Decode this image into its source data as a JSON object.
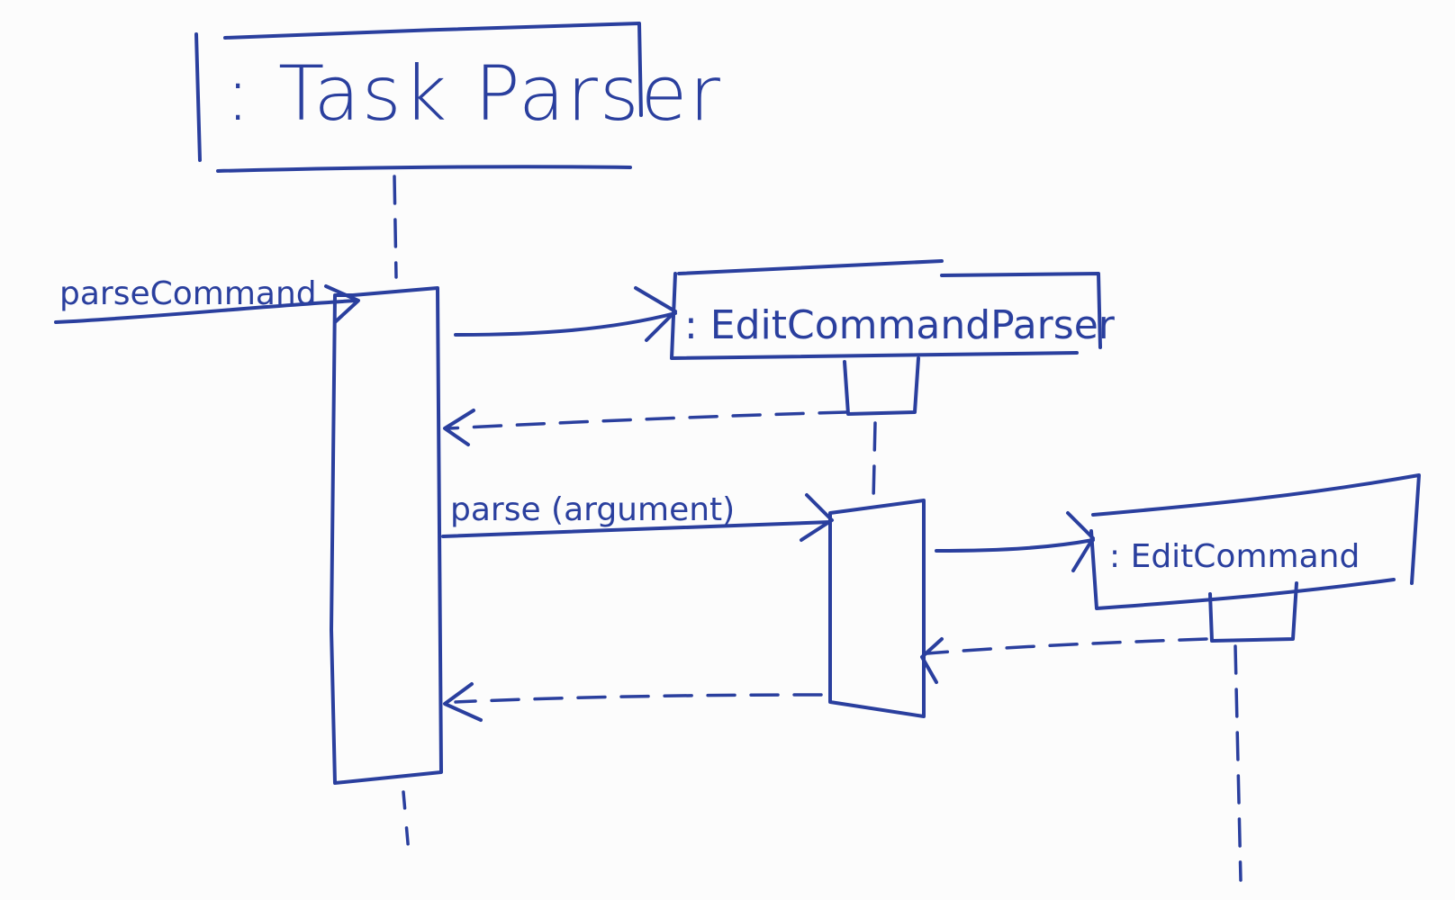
{
  "participants": {
    "task_parser": ": Task Parser",
    "edit_command_parser": ": EditCommandParser",
    "edit_command": ": EditCommand"
  },
  "messages": {
    "parse_command": "parseCommand",
    "parse_argument": "parse (argument)"
  },
  "colors": {
    "ink": "#2a3f9e",
    "paper": "#fcfcfc"
  }
}
